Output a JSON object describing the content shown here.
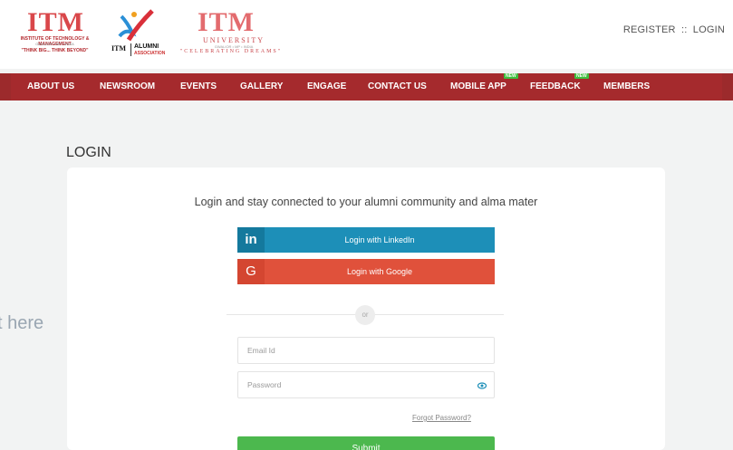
{
  "header": {
    "logo_itm": {
      "big": "ITM",
      "sub1": "INSTITUTE OF TECHNOLOGY & MANAGEMENT",
      "sub2": "GWALIOR • MP • INDIA",
      "tagline": "\"THINK BIG... THINK BEYOND\""
    },
    "logo_alumni": {
      "itm": "ITM",
      "line1": "ALUMNI",
      "line2": "ASSOCIATION"
    },
    "logo_university": {
      "big": "ITM",
      "sub": "UNIVERSITY",
      "sub2": "GWALIOR • MP • INDIA",
      "tagline": "\"CELEBRATING DREAMS\""
    },
    "auth": {
      "register": "REGISTER",
      "separator": "::",
      "login": "LOGIN"
    }
  },
  "nav": {
    "items": [
      "ABOUT US",
      "NEWSROOM",
      "EVENTS",
      "GALLERY",
      "ENGAGE",
      "CONTACT US",
      "MOBILE APP",
      "FEEDBACK",
      "MEMBERS"
    ],
    "badge": "NEW"
  },
  "login": {
    "heading": "LOGIN",
    "tagline": "Login and stay connected to your alumni community and alma mater",
    "linkedin": {
      "icon": "in",
      "label": "Login with LinkedIn"
    },
    "google": {
      "icon": "G",
      "label": "Login with Google"
    },
    "or": "or",
    "email_placeholder": "Email Id",
    "password_placeholder": "Password",
    "forgot": "Forgot Password?",
    "submit": "Submit"
  },
  "ghost_text": "t here",
  "colors": {
    "nav_bg": "#a52a2d",
    "linkedin": "#1d8fb8",
    "google": "#e0513b",
    "submit": "#4cb84e",
    "page_bg": "#f2f3f3"
  }
}
